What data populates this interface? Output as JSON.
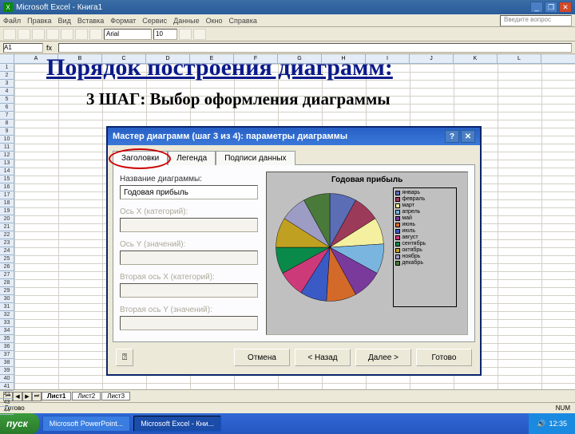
{
  "titlebar": {
    "app": "Microsoft Excel",
    "doc": "Книга1"
  },
  "menu": [
    "Файл",
    "Правка",
    "Вид",
    "Вставка",
    "Формат",
    "Сервис",
    "Данные",
    "Окно",
    "Справка"
  ],
  "ask": "Введите вопрос",
  "formula": {
    "name": "A1"
  },
  "cols": [
    "A",
    "B",
    "C",
    "D",
    "E",
    "F",
    "G",
    "H",
    "I",
    "J",
    "K",
    "L"
  ],
  "heading": "Порядок построения диаграмм:",
  "subheading": "3 ШАГ: Выбор оформления диаграммы",
  "dialog": {
    "title": "Мастер диаграмм (шаг 3 из 4): параметры диаграммы",
    "tabs": [
      "Заголовки",
      "Легенда",
      "Подписи данных"
    ],
    "labels": {
      "name": "Название диаграммы:",
      "axisX": "Ось X (категорий):",
      "axisY": "Ось Y (значений):",
      "axisX2": "Вторая ось X (категорий):",
      "axisY2": "Вторая ось Y (значений):"
    },
    "values": {
      "name": "Годовая прибыль"
    },
    "chartTitle": "Годовая прибыль",
    "buttons": {
      "cancel": "Отмена",
      "back": "< Назад",
      "next": "Далее >",
      "finish": "Готово"
    }
  },
  "chart_data": {
    "type": "pie",
    "title": "Годовая прибыль",
    "categories": [
      "январь",
      "февраль",
      "март",
      "апрель",
      "май",
      "июнь",
      "июль",
      "август",
      "сентябрь",
      "октябрь",
      "ноябрь",
      "декабрь"
    ],
    "values": [
      8,
      8,
      8,
      9,
      9,
      9,
      8,
      8,
      8,
      9,
      8,
      8
    ],
    "colors": [
      "#5a6db5",
      "#9c3a5a",
      "#f5f0a0",
      "#7ab5e0",
      "#7a3a9c",
      "#d46a2a",
      "#3a5ac5",
      "#cc3a7a",
      "#0a8a4a",
      "#c0a020",
      "#9c9cc5",
      "#4a7a3a"
    ]
  },
  "sheets": [
    "Лист1",
    "Лист2",
    "Лист3"
  ],
  "status": "Готово",
  "taskbar": {
    "start": "пуск",
    "items": [
      "Microsoft PowerPoint...",
      "Microsoft Excel - Кни..."
    ],
    "time": "12:35"
  }
}
